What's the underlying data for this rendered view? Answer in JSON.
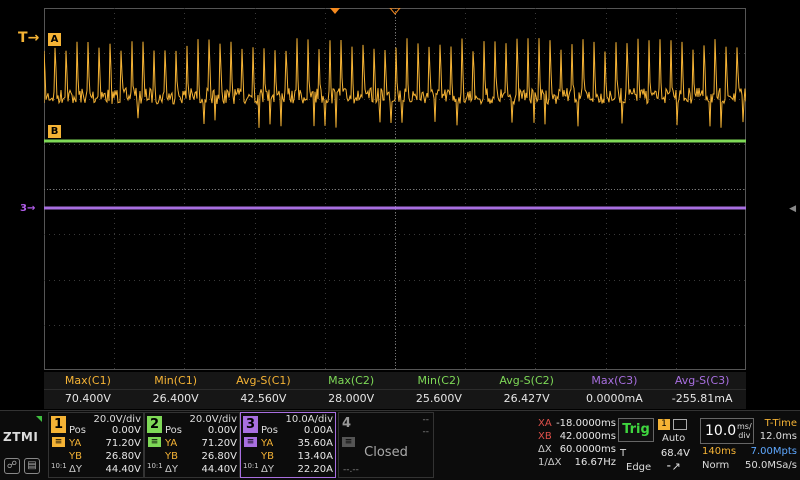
{
  "colors": {
    "ch1": "#f5b335",
    "ch2": "#7ed957",
    "ch3": "#a86fe0",
    "trigger_ok": "#3fd63f",
    "points": "#5ea8ff"
  },
  "markers": {
    "trigger": "T",
    "cursor_a": "A",
    "cursor_b": "B",
    "ch3_offset": "3"
  },
  "measurements": {
    "headers": [
      "Max(C1)",
      "Min(C1)",
      "Avg-S(C1)",
      "Max(C2)",
      "Min(C2)",
      "Avg-S(C2)",
      "Max(C3)",
      "Avg-S(C3)"
    ],
    "header_colors": [
      "#f5b335",
      "#f5b335",
      "#f5b335",
      "#7ed957",
      "#7ed957",
      "#7ed957",
      "#a86fe0",
      "#a86fe0"
    ],
    "values": [
      "70.400V",
      "26.400V",
      "42.560V",
      "28.000V",
      "25.600V",
      "26.427V",
      "0.0000mA",
      "-255.81mA"
    ]
  },
  "logo": {
    "text": "ZTMI",
    "icons": [
      "probe-icon",
      "screenshot-icon"
    ]
  },
  "channels": [
    {
      "num": "1",
      "scale": "20.0V/div",
      "pos_label": "Pos",
      "pos": "0.00V",
      "ya_label": "YA",
      "ya": "71.20V",
      "yb_label": "YB",
      "yb": "26.80V",
      "dy_label": "ΔY",
      "dy": "44.40V",
      "bw": "10:1"
    },
    {
      "num": "2",
      "scale": "20.0V/div",
      "pos_label": "Pos",
      "pos": "0.00V",
      "ya_label": "YA",
      "ya": "71.20V",
      "yb_label": "YB",
      "yb": "26.80V",
      "dy_label": "ΔY",
      "dy": "44.40V",
      "bw": "10:1"
    },
    {
      "num": "3",
      "scale": "10.0A/div",
      "pos_label": "Pos",
      "pos": "0.00A",
      "ya_label": "YA",
      "ya": "35.60A",
      "yb_label": "YB",
      "yb": "13.40A",
      "dy_label": "ΔY",
      "dy": "22.20A",
      "bw": "10:1"
    },
    {
      "num": "4",
      "scale": "--",
      "pos": "--"
    }
  ],
  "closed_panel": {
    "label": "Closed",
    "dash": "--",
    "dash2": "--",
    "dash3": "--.--"
  },
  "cursors": {
    "xa_label": "XA",
    "xa": "-18.0000ms",
    "xb_label": "XB",
    "xb": "42.0000ms",
    "dx_label": "ΔX",
    "dx": "60.0000ms",
    "inv_label": "1/ΔX",
    "inv": "16.67Hz"
  },
  "trigger": {
    "state": "Trig",
    "source": "1",
    "mode": "Auto",
    "level_label": "T",
    "level": "68.4V",
    "type": "Edge"
  },
  "timebase": {
    "value": "10.0",
    "unit_top": "ms/",
    "unit_bottom": "div",
    "mode": "T-Time",
    "delay": "12.0ms",
    "span": "140ms",
    "points": "7.00Mpts",
    "acq": "Norm",
    "rate": "50.0MSa/s"
  }
}
